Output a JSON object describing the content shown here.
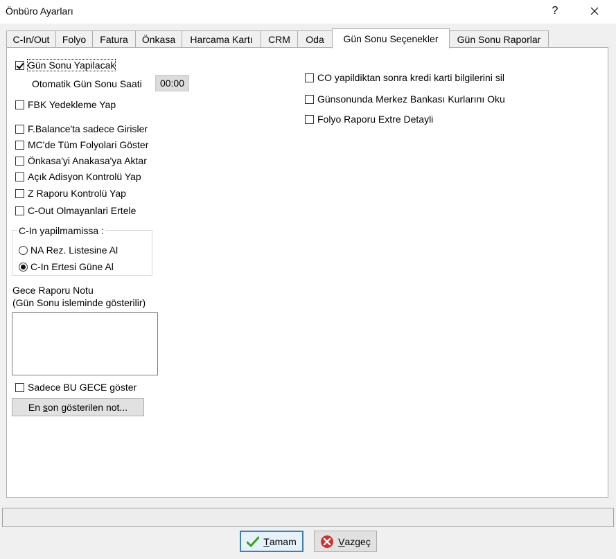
{
  "window": {
    "title": "Önbüro Ayarları",
    "help": "?",
    "close": "✕"
  },
  "tabs": [
    {
      "label": "C-In/Out"
    },
    {
      "label": "Folyo"
    },
    {
      "label": "Fatura"
    },
    {
      "label": "Önkasa"
    },
    {
      "label": "Harcama Kartı"
    },
    {
      "label": "CRM"
    },
    {
      "label": "Oda"
    },
    {
      "label": "Gün Sonu Seçenekler"
    },
    {
      "label": "Gün Sonu Raporlar"
    }
  ],
  "left": {
    "gun_sonu": {
      "label": "Gün Sonu Yapilacak",
      "checked": true
    },
    "auto_time_label": "Otomatik Gün Sonu Saati",
    "auto_time_value": "00:00",
    "fbk": {
      "label": "FBK Yedekleme Yap",
      "checked": false
    },
    "options": [
      {
        "label": "F.Balance'ta sadece Girisler",
        "checked": false
      },
      {
        "label": "MC'de Tüm Folyolari Göster",
        "checked": false
      },
      {
        "label": "Önkasa'yi Anakasa'ya Aktar",
        "checked": false
      },
      {
        "label": "Açık Adisyon Kontrolü Yap",
        "checked": false
      },
      {
        "label": "Z Raporu Kontrolü Yap",
        "checked": false
      },
      {
        "label": "C-Out Olmayanlari Ertele",
        "checked": false
      }
    ],
    "cin_group": {
      "legend": "C-In yapilmamissa :",
      "radios": [
        {
          "label": "NA Rez. Listesine Al",
          "checked": false
        },
        {
          "label": "C-In Ertesi Güne Al",
          "checked": true
        }
      ]
    },
    "note_label_1": "Gece Raporu Notu",
    "note_label_2": "(Gün Sonu isleminde gösterilir)",
    "note_value": "",
    "only_tonight": {
      "label": "Sadece BU GECE göster",
      "checked": false
    },
    "last_note_btn": {
      "prefix": "En ",
      "underline": "s",
      "suffix": "on gösterilen not..."
    }
  },
  "right": {
    "options": [
      {
        "label": "CO yapildiktan sonra kredi karti bilgilerini sil",
        "checked": false
      },
      {
        "label": "Günsonunda Merkez Bankası Kurlarını Oku",
        "checked": false
      },
      {
        "label": "Folyo Raporu Extre Detayli",
        "checked": false
      }
    ]
  },
  "footer": {
    "ok": {
      "underline": "T",
      "rest": "amam"
    },
    "cancel": {
      "underline": "V",
      "rest": "azgeç"
    }
  },
  "colors": {
    "ok_check": "#3a9d23",
    "cancel_red": "#d32f2f"
  }
}
